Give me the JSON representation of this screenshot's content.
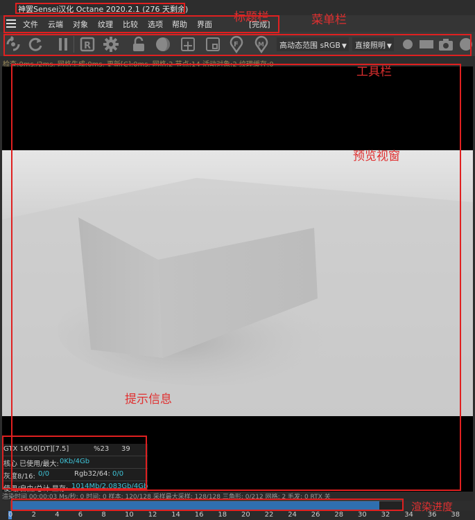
{
  "window": {
    "title": "神罢Sensei汉化 Octane 2020.2.1 (276 天剩余)"
  },
  "menu": {
    "items": [
      "文件",
      "云端",
      "对象",
      "纹理",
      "比较",
      "选项",
      "帮助",
      "界面"
    ],
    "status": "[完成]"
  },
  "toolbar": {
    "color_space": "高动态范围 sRGB",
    "kernel": "直接照明"
  },
  "status_line": "检查:0ms./2ms. 网格生成:0ms. 更新[C]:0ms. 网格:2 节点:14 活动对象:2 纹理缓存:0",
  "stats": {
    "gpu": "GTX 1650[DT][7.5]",
    "gpu_percent": "%23",
    "gpu_temp": "39",
    "core_label": "核心 已使用/最大:",
    "core_value": "0Kb/4Gb",
    "grey_label": "灰度8/16:",
    "grey_value": "0/0",
    "rgb_label": "Rgb32/64:",
    "rgb_value": "0/0",
    "mem_label": "使用/自由/总计 显存:",
    "mem_value": "1014Mb/2.083Gb/4Gb"
  },
  "bottom_status": "渲染时间 00:00:03  Ms/秒: 0  时间: 0  样本: 120/128  采样最大采样: 128/128  三角形: 0/212  网格: 2  毛发: 0  RTX 关",
  "progress": {
    "fraction": 0.94
  },
  "timeline": {
    "ticks": [
      "0",
      "2",
      "4",
      "6",
      "8",
      "10",
      "12",
      "14",
      "16",
      "18",
      "20",
      "22",
      "24",
      "26",
      "28",
      "30",
      "32",
      "34",
      "36",
      "38"
    ]
  },
  "annotations": {
    "title_bar": "标题栏",
    "menu_bar": "菜单栏",
    "toolbar": "工具栏",
    "preview": "预览视窗",
    "hint": "提示信息",
    "progress": "渲染进度"
  },
  "colors": {
    "annotation": "#e02020",
    "accent_cyan": "#3ec4d8",
    "progress": "#2f6fb0"
  }
}
